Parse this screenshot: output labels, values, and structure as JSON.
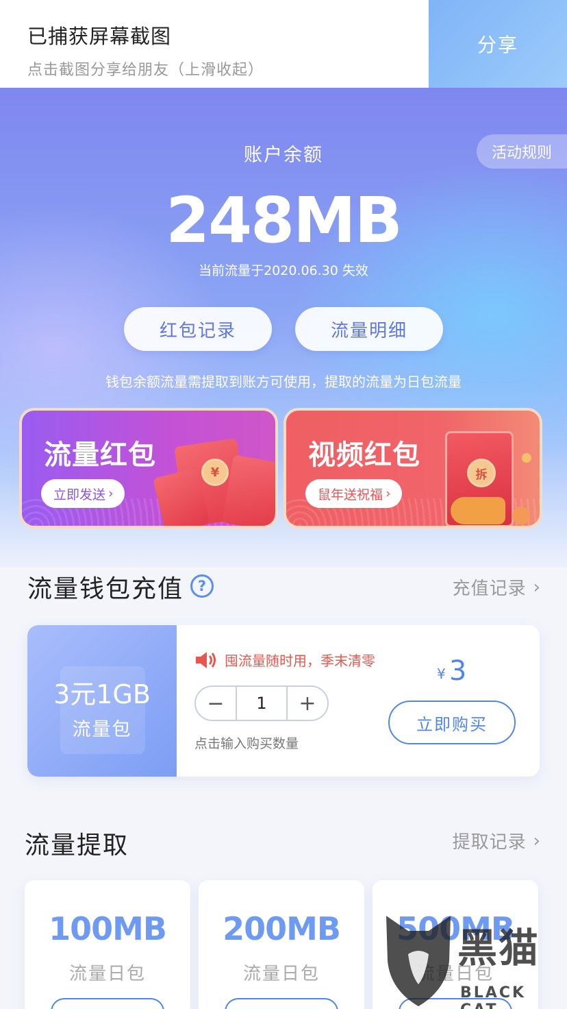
{
  "screenshot_bar": {
    "title": "已捕获屏幕截图",
    "subtitle": "点击截图分享给朋友（上滑收起）",
    "share_label": "分享"
  },
  "hero": {
    "rules_label": "活动规则",
    "balance_label": "账户余额",
    "balance_value": "248MB",
    "expire_text": "当前流量于2020.06.30 失效",
    "red_packet_record_label": "红包记录",
    "flow_detail_label": "流量明细",
    "hint": "钱包余额流量需提取到账方可使用，提取的流量为日包流量"
  },
  "packets": {
    "flow": {
      "title": "流量红包",
      "button": "立即发送"
    },
    "video": {
      "title": "视频红包",
      "button": "鼠年送祝福",
      "seal": "拆"
    },
    "flow_seal": "¥"
  },
  "recharge": {
    "title": "流量钱包充值",
    "help": "?",
    "record_label": "充值记录",
    "package_size": "3元1GB",
    "package_name": "流量包",
    "notice": "囤流量随时用，季末清零",
    "quantity": "1",
    "minus": "−",
    "plus": "+",
    "quantity_hint": "点击输入购买数量",
    "price_symbol": "¥",
    "price": "3",
    "buy_label": "立即购买"
  },
  "extract": {
    "title": "流量提取",
    "record_label": "提取记录",
    "items": [
      {
        "size": "100MB",
        "name": "流量日包"
      },
      {
        "size": "200MB",
        "name": "流量日包"
      },
      {
        "size": "500MB",
        "name": "流量日包"
      }
    ]
  },
  "watermark": {
    "text": "黑猫",
    "sub": "BLACK CAT"
  },
  "colors": {
    "accent_blue": "#4f86ee",
    "notice_red": "#e8574e",
    "hero_purple": "#7f87ef",
    "packet_purple": "#9a5cf0",
    "packet_red": "#ef5f63"
  }
}
